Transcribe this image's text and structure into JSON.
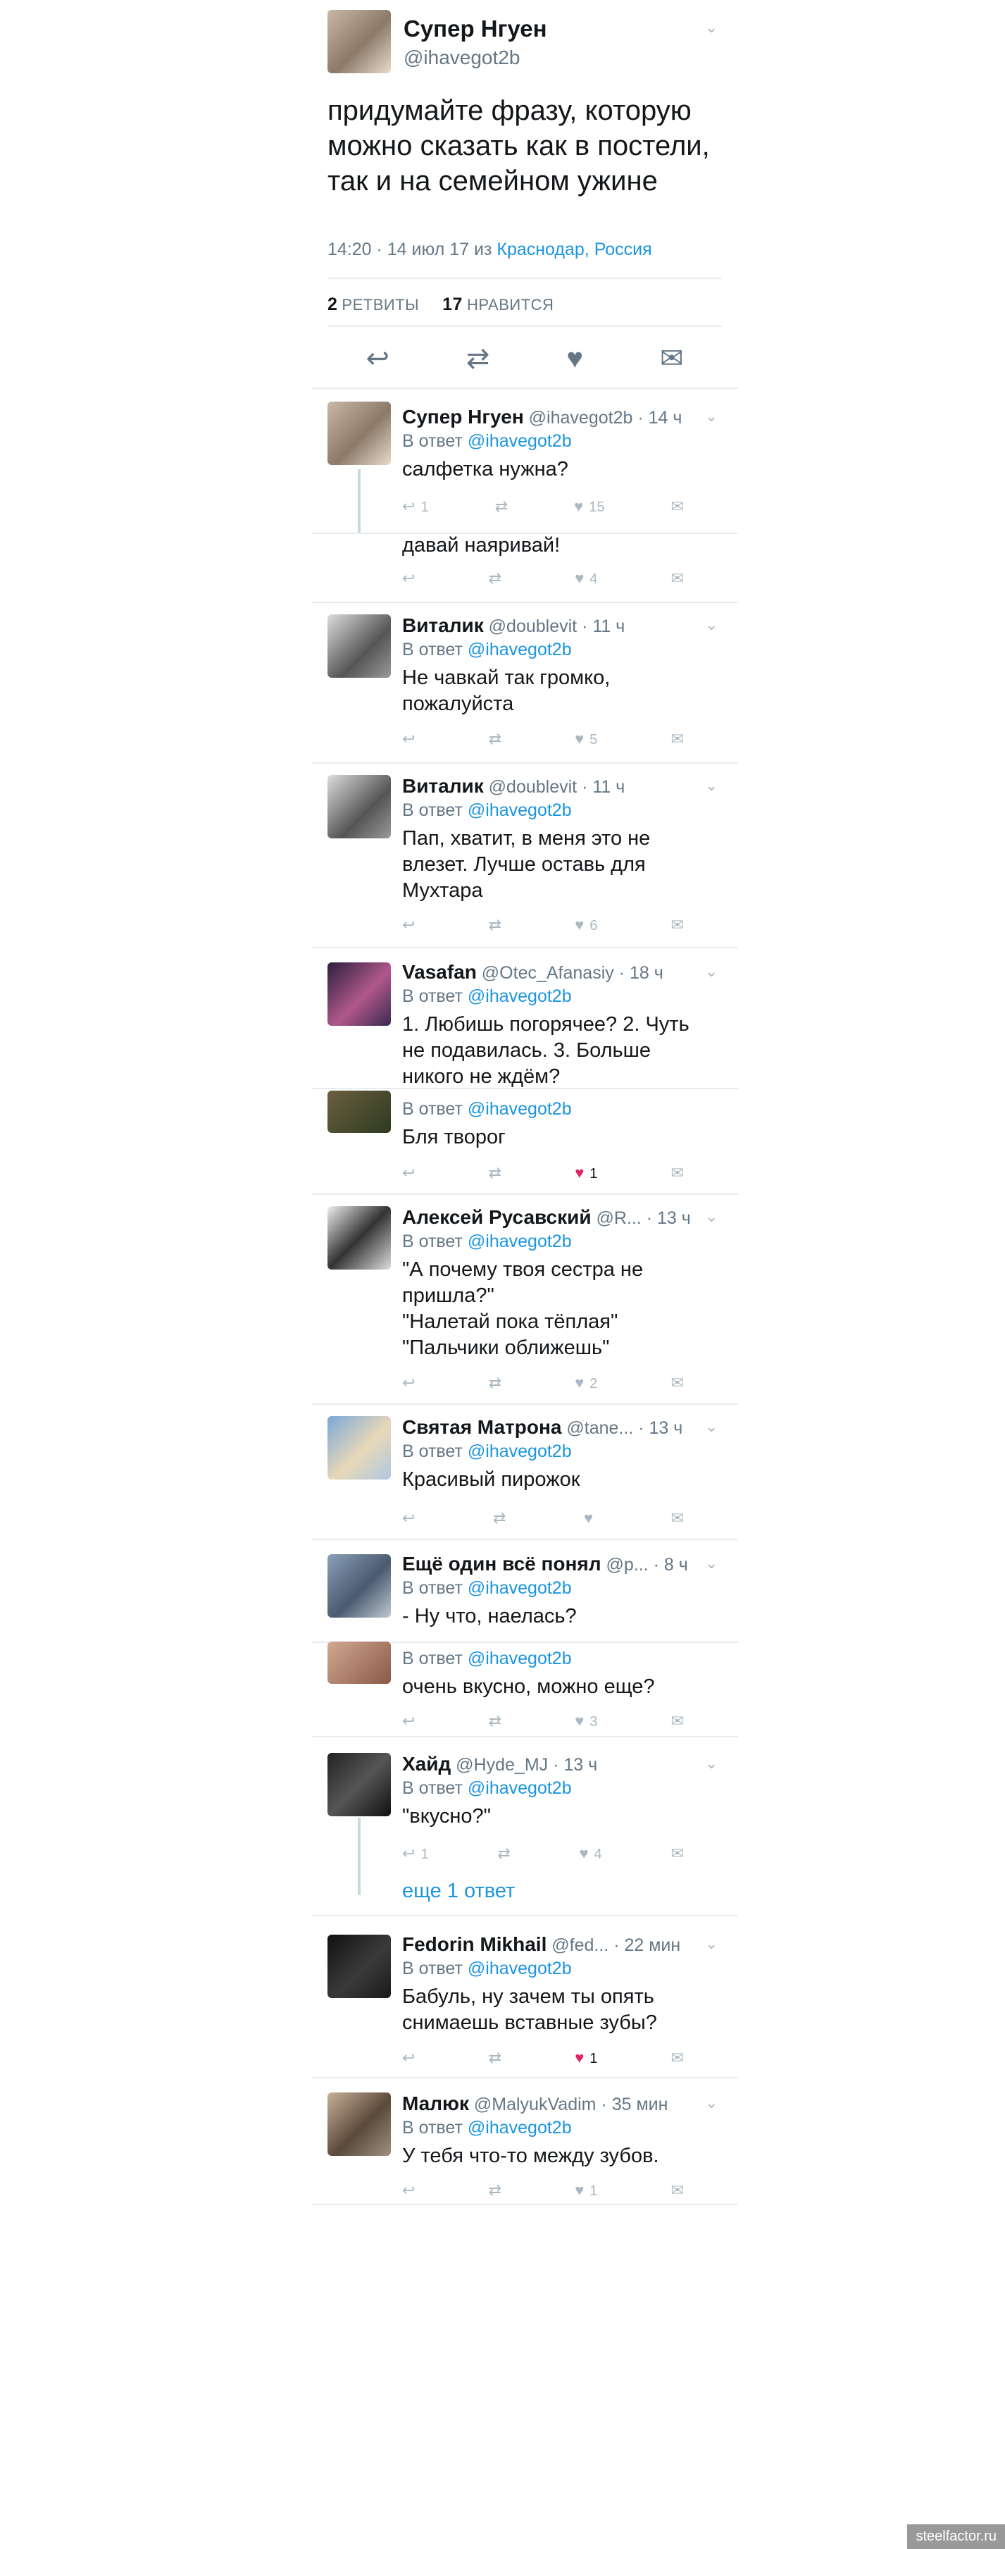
{
  "main": {
    "name": "Супер Нгуен",
    "handle": "@ihavegot2b",
    "text": "придумайте фразу, которую можно сказать как в постели, так и на семейном ужине",
    "time": "14:20 · 14 июл 17 из",
    "location": "Краснодар, Россия",
    "retweets_count": "2",
    "retweets_label": "РЕТВИТЫ",
    "likes_count": "17",
    "likes_label": "НРАВИТСЯ"
  },
  "in_reply_label": "В ответ",
  "in_reply_handle": "@ihavegot2b",
  "replies": [
    {
      "name": "Супер Нгуен",
      "sub": "@ihavegot2b · 14 ч",
      "text": "салфетка нужна?",
      "replies": "1",
      "likes": "15",
      "liked": false
    },
    {
      "name": "",
      "sub": "",
      "text": "давай наяривай!",
      "replies": "",
      "likes": "4",
      "liked": false
    },
    {
      "name": "Виталик",
      "sub": "@doublevit · 11 ч",
      "text": "Не чавкай так громко, пожалуйста",
      "replies": "",
      "likes": "5",
      "liked": false
    },
    {
      "name": "Виталик",
      "sub": "@doublevit · 11 ч",
      "text": "Пап, хватит, в меня это не влезет. Лучше оставь для Мухтара",
      "replies": "",
      "likes": "6",
      "liked": false
    },
    {
      "name": "Vasafan",
      "sub": "@Otec_Afanasiy · 18 ч",
      "text": "1. Любишь погорячее? 2. Чуть не подавилась. 3. Больше никого не ждём?",
      "replies": "",
      "likes": "",
      "liked": false
    },
    {
      "name": "",
      "sub": "",
      "text": "Бля творог",
      "replies": "",
      "likes": "1",
      "liked": true
    },
    {
      "name": "Алексей Русавский",
      "sub": "@R... · 13 ч",
      "text": "\"А почему твоя сестра не пришла?\"\n\"Налетай пока тёплая\"\n\"Пальчики оближешь\"",
      "replies": "",
      "likes": "2",
      "liked": false
    },
    {
      "name": "Святая Матрона",
      "sub": "@tane... · 13 ч",
      "text": "Красивый пирожок",
      "replies": "",
      "likes": "",
      "liked": false
    },
    {
      "name": "Ещё один всё понял",
      "sub": "@p... · 8 ч",
      "text": "- Ну что, наелась?",
      "replies": "",
      "likes": "",
      "liked": false
    },
    {
      "name": "",
      "sub": "",
      "text": "очень вкусно, можно еще?",
      "replies": "",
      "likes": "3",
      "liked": false
    },
    {
      "name": "Хайд",
      "sub": "@Hyde_MJ · 13 ч",
      "text": "\"вкусно?\"",
      "replies": "1",
      "likes": "4",
      "liked": false
    },
    {
      "name": "Fedorin Mikhail",
      "sub": "@fed... · 22 мин",
      "text": "Бабуль, ну зачем ты опять снимаешь вставные зубы?",
      "replies": "",
      "likes": "1",
      "liked": true
    },
    {
      "name": "Малюк",
      "sub": "@MalyukVadim · 35 мин",
      "text": "У тебя что-то между зубов.",
      "replies": "",
      "likes": "1",
      "liked": false
    }
  ],
  "more_replies": "еще 1 ответ",
  "watermark": "steelfactor.ru",
  "icons": {
    "reply": "reply-icon",
    "retweet": "retweet-icon",
    "like": "heart-icon",
    "dm": "envelope-icon",
    "menu": "chevron-down-icon"
  },
  "colors": {
    "link": "#1b95e0",
    "like": "#e0245e",
    "muted": "#657786"
  }
}
